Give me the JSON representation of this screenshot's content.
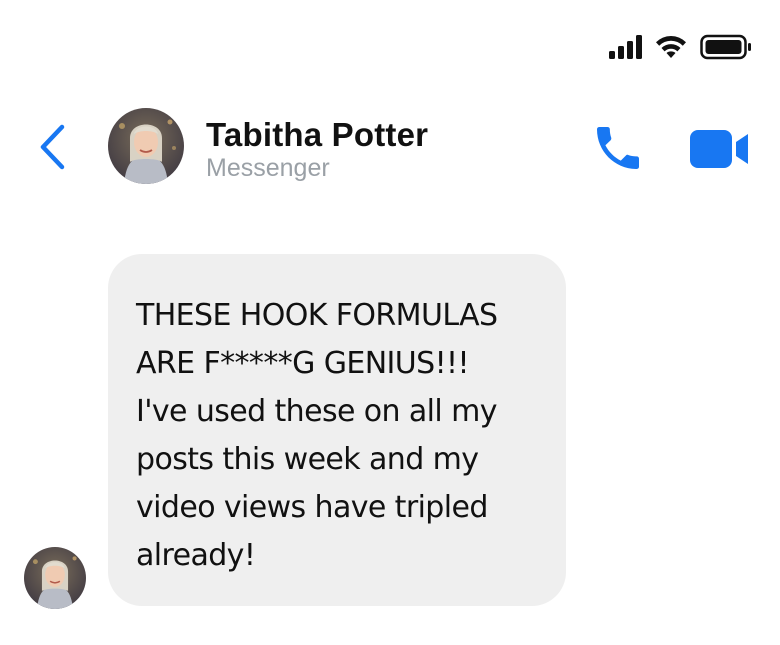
{
  "status_bar": {
    "signal_icon": "signal-bars-icon",
    "wifi_icon": "wifi-icon",
    "battery_icon": "battery-icon"
  },
  "header": {
    "back_icon": "chevron-left-icon",
    "contact_name": "Tabitha Potter",
    "contact_subtitle": "Messenger",
    "call_icon": "phone-icon",
    "video_icon": "video-camera-icon",
    "accent_color": "#1877f2"
  },
  "conversation": {
    "messages": [
      {
        "text": "THESE HOOK FORMULAS\nARE F*****G GENIUS!!!\nI've used these on all my\nposts this week and my\nvideo views have tripled\nalready!",
        "bubble_color": "#efefef"
      }
    ]
  }
}
